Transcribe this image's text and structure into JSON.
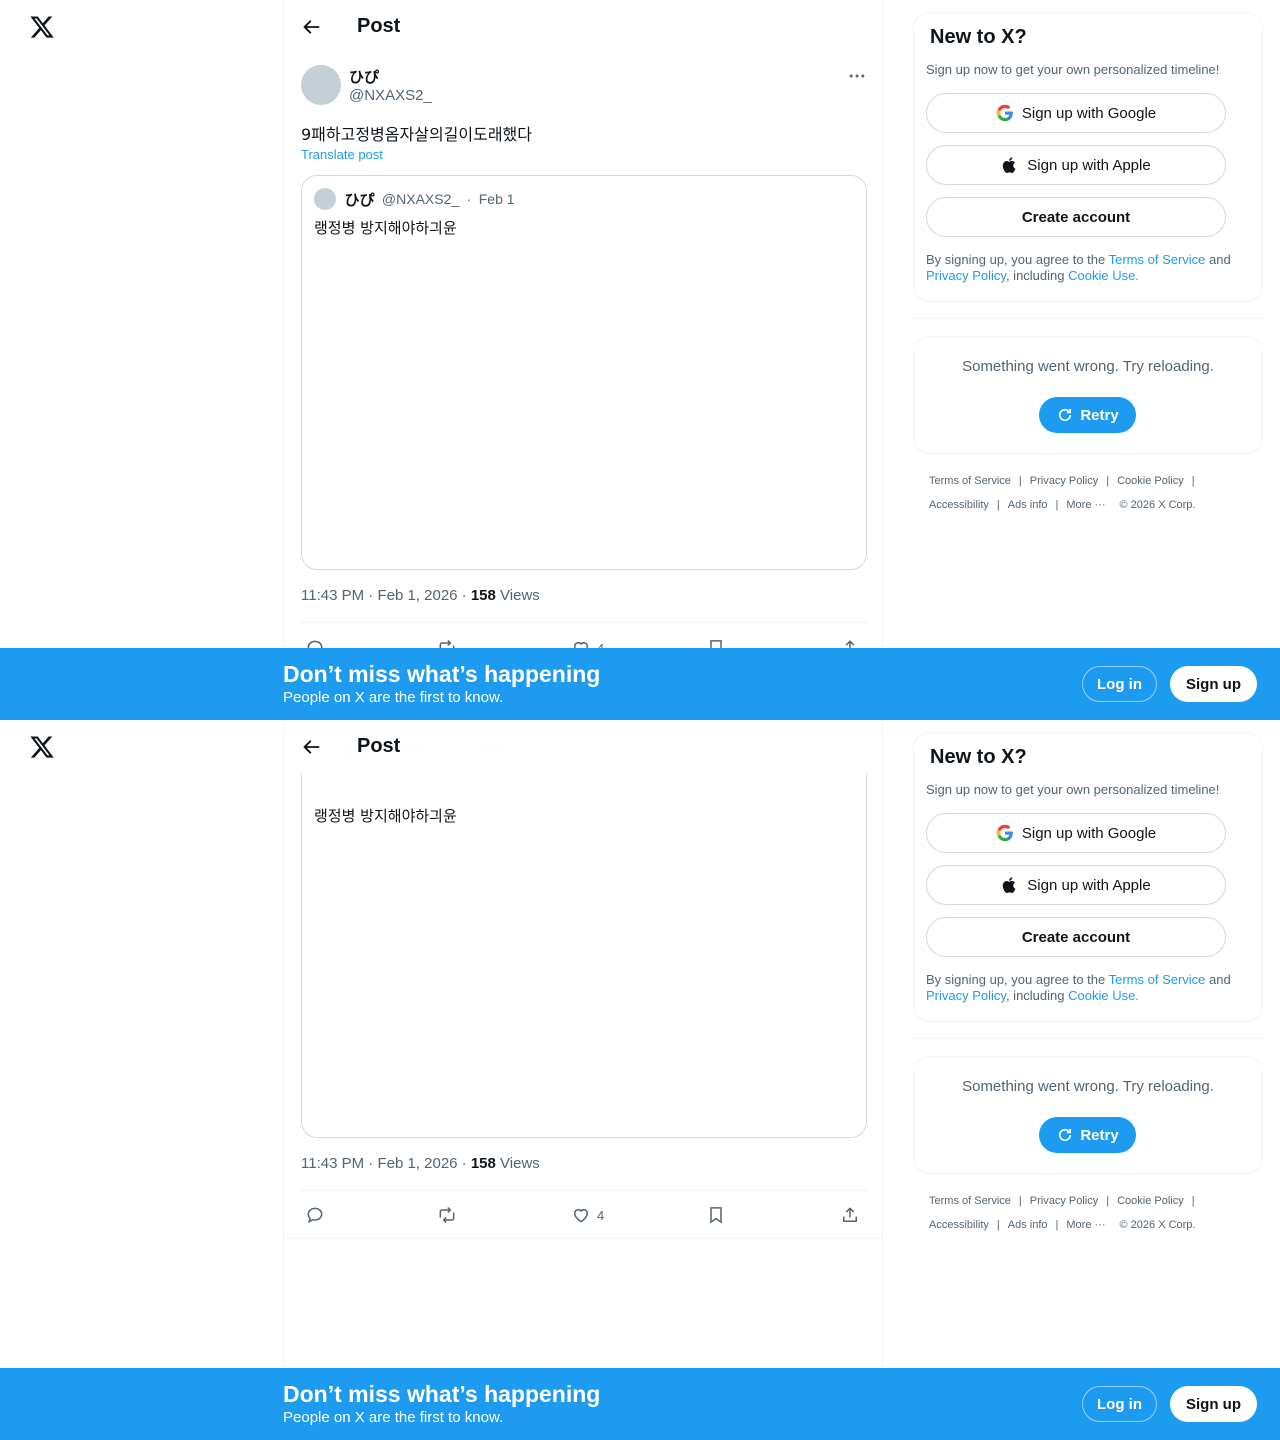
{
  "nav": {
    "logo_icon": "x-logo-icon"
  },
  "header": {
    "title": "Post",
    "back_icon": "arrow-left-icon"
  },
  "post": {
    "author_name": "ひぴ",
    "author_handle": "@NXAXS2_",
    "text": "9패하고정병옴자살의길이도래했다",
    "translate_label": "Translate post",
    "time": "11:43 PM",
    "date": "Feb 1, 2026",
    "views_count": "158",
    "views_label": "Views",
    "quote": {
      "author_name": "ひぴ",
      "author_handle": "@NXAXS2_",
      "separator": "·",
      "date": "Feb 1",
      "text": "랭정병 방지해야하긔윤"
    },
    "actions": {
      "reply_count": "",
      "repost_count": "",
      "like_count": "4",
      "bookmark_count": ""
    }
  },
  "sidebar": {
    "signup_card": {
      "title": "New to X?",
      "subtitle": "Sign up now to get your own personalized timeline!",
      "google_label": "Sign up with Google",
      "apple_label": "Sign up with Apple",
      "create_label": "Create account",
      "legal_prefix": "By signing up, you agree to the ",
      "terms": "Terms of Service",
      "and": " and",
      "privacy": "Privacy Policy",
      "including": ", including ",
      "cookie": "Cookie Use."
    },
    "error_card": {
      "message": "Something went wrong. Try reloading.",
      "retry_label": "Retry"
    },
    "footer": {
      "terms": "Terms of Service",
      "privacy": "Privacy Policy",
      "cookie": "Cookie Policy",
      "accessibility": "Accessibility",
      "ads": "Ads info",
      "more": "More",
      "copyright": "© 2026 X Corp.",
      "separator": "|"
    }
  },
  "banner": {
    "title": "Don’t miss what’s happening",
    "subtitle": "People on X are the first to know.",
    "login_label": "Log in",
    "signup_label": "Sign up"
  },
  "colors": {
    "accent": "#1d9bf0",
    "text": "#0f1419",
    "muted": "#536471",
    "border": "#cfd9de",
    "banner": "#1d9bf0"
  }
}
